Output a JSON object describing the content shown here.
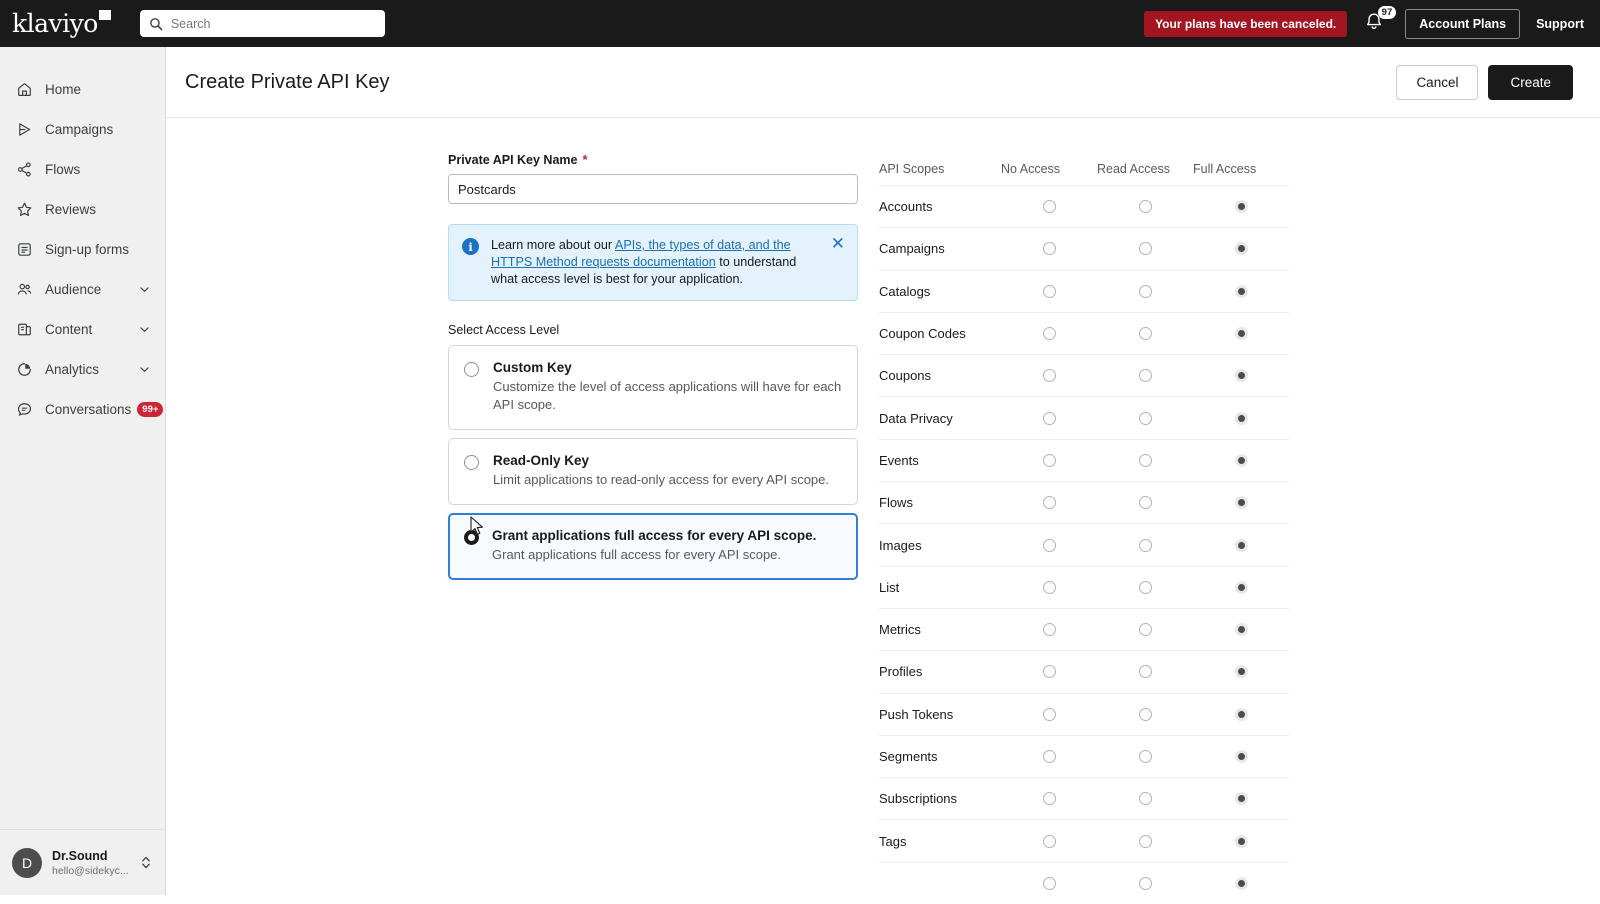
{
  "topbar": {
    "logo_text": "klaviyo",
    "search_placeholder": "Search",
    "search_value": "",
    "search_icon": "search-icon",
    "plan_alert": "Your plans have been canceled.",
    "bell_icon": "bell-icon",
    "bell_badge": "97",
    "account_plans_label": "Account Plans",
    "support_label": "Support"
  },
  "sidebar": {
    "items": [
      {
        "label": "Home",
        "icon": "home-icon",
        "chevron": false,
        "badge": ""
      },
      {
        "label": "Campaigns",
        "icon": "campaigns-icon",
        "chevron": false,
        "badge": ""
      },
      {
        "label": "Flows",
        "icon": "flows-icon",
        "chevron": false,
        "badge": ""
      },
      {
        "label": "Reviews",
        "icon": "star-icon",
        "chevron": false,
        "badge": ""
      },
      {
        "label": "Sign-up forms",
        "icon": "form-icon",
        "chevron": false,
        "badge": ""
      },
      {
        "label": "Audience",
        "icon": "audience-icon",
        "chevron": true,
        "badge": ""
      },
      {
        "label": "Content",
        "icon": "content-icon",
        "chevron": true,
        "badge": ""
      },
      {
        "label": "Analytics",
        "icon": "analytics-icon",
        "chevron": true,
        "badge": ""
      },
      {
        "label": "Conversations",
        "icon": "conversations-icon",
        "chevron": false,
        "badge": "99+"
      }
    ],
    "profile": {
      "initial": "D",
      "name": "Dr.Sound",
      "email": "hello@sidekyc...",
      "chevrons_icon": "chevron-up-down-icon"
    }
  },
  "page": {
    "title": "Create Private API Key",
    "cancel_label": "Cancel",
    "create_label": "Create"
  },
  "form": {
    "name_label": "Private API Key Name",
    "required_marker": "*",
    "name_value": "Postcards",
    "name_placeholder": "",
    "banner": {
      "icon": "info-icon",
      "text_before": "Learn more about our ",
      "link_text": "APIs, the types of data, and the HTTPS Method requests documentation",
      "text_after": " to understand what access level is best for your application.",
      "close_icon": "close-icon",
      "close_label": "✕"
    },
    "access_level_label": "Select Access Level",
    "options": [
      {
        "title": "Custom Key",
        "desc": "Customize the level of access applications will have for each API scope.",
        "selected": false
      },
      {
        "title": "Read-Only Key",
        "desc": "Limit applications to read-only access for every API scope.",
        "selected": false
      },
      {
        "title": "Grant applications full access for every API scope.",
        "desc": "Grant applications full access for every API scope.",
        "selected": true
      }
    ]
  },
  "scopes_table": {
    "columns": [
      "API Scopes",
      "No Access",
      "Read Access",
      "Full Access"
    ],
    "rows": [
      {
        "name": "Accounts",
        "access": "Full Access"
      },
      {
        "name": "Campaigns",
        "access": "Full Access"
      },
      {
        "name": "Catalogs",
        "access": "Full Access"
      },
      {
        "name": "Coupon Codes",
        "access": "Full Access"
      },
      {
        "name": "Coupons",
        "access": "Full Access"
      },
      {
        "name": "Data Privacy",
        "access": "Full Access"
      },
      {
        "name": "Events",
        "access": "Full Access"
      },
      {
        "name": "Flows",
        "access": "Full Access"
      },
      {
        "name": "Images",
        "access": "Full Access"
      },
      {
        "name": "List",
        "access": "Full Access"
      },
      {
        "name": "Metrics",
        "access": "Full Access"
      },
      {
        "name": "Profiles",
        "access": "Full Access"
      },
      {
        "name": "Push Tokens",
        "access": "Full Access"
      },
      {
        "name": "Segments",
        "access": "Full Access"
      },
      {
        "name": "Subscriptions",
        "access": "Full Access"
      },
      {
        "name": "Tags",
        "access": "Full Access"
      },
      {
        "name": "",
        "access": "Full Access"
      }
    ]
  },
  "colors": {
    "accent_blue": "#2f7ed8",
    "alert_red": "#a31621",
    "badge_red": "#cf2338",
    "dark": "#1a1a1a",
    "sidebar_bg": "#eff0ef",
    "banner_bg": "#e3f2fd"
  }
}
